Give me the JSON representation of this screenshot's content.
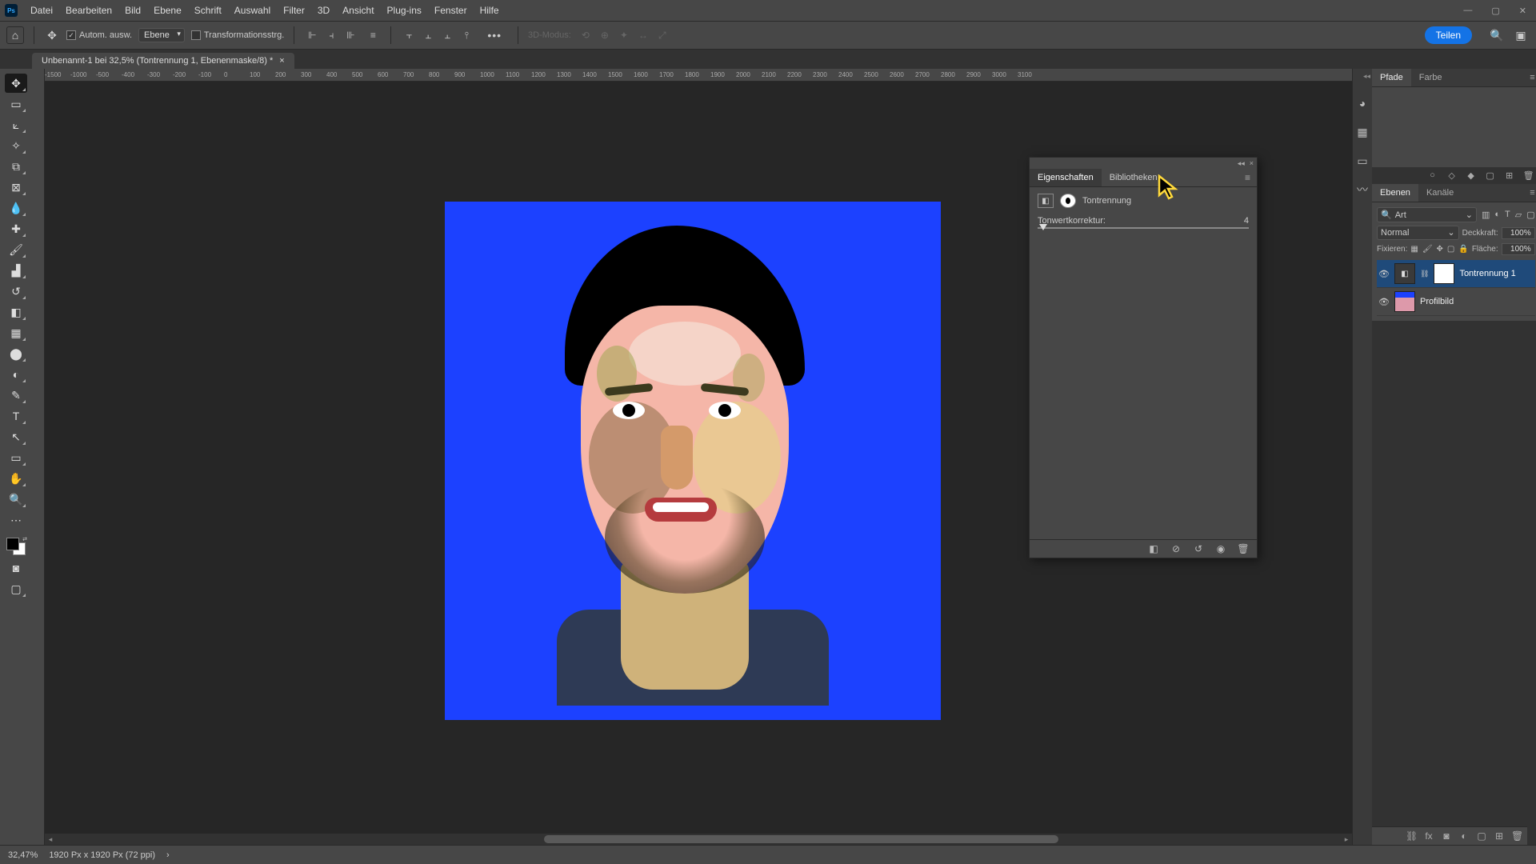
{
  "menu": {
    "items": [
      "Datei",
      "Bearbeiten",
      "Bild",
      "Ebene",
      "Schrift",
      "Auswahl",
      "Filter",
      "3D",
      "Ansicht",
      "Plug-ins",
      "Fenster",
      "Hilfe"
    ],
    "logo": "Ps"
  },
  "options": {
    "auto_select_checked": true,
    "auto_select_label": "Autom. ausw.",
    "layer_dropdown": "Ebene",
    "transform_checked": false,
    "transform_label": "Transformationsstrg.",
    "mode_label_disabled": "3D-Modus:",
    "share_button": "Teilen"
  },
  "document": {
    "tab_title": "Unbenannt-1 bei 32,5% (Tontrennung 1, Ebenenmaske/8) *"
  },
  "ruler": {
    "values": [
      "-1500",
      "-1000",
      "-500",
      "-400",
      "-300",
      "-200",
      "-100",
      "0",
      "100",
      "200",
      "300",
      "400",
      "500",
      "600",
      "700",
      "800",
      "900",
      "1000",
      "1100",
      "1200",
      "1300",
      "1400",
      "1500",
      "1600",
      "1700",
      "1800",
      "1900",
      "2000",
      "2100",
      "2200",
      "2300",
      "2400",
      "2500",
      "2600",
      "2700",
      "2800",
      "2900",
      "3000",
      "3100"
    ]
  },
  "float_panel": {
    "collapse_icon": "◂◂",
    "close_icon": "×",
    "tabs": {
      "properties": "Eigenschaften",
      "libraries": "Bibliotheken"
    },
    "adjustment_name": "Tontrennung",
    "slider_label": "Tonwertkorrektur:",
    "slider_value": "4",
    "footer_icons": {
      "clip": "◧",
      "view": "⊘",
      "reset": "↺",
      "toggle": "◉",
      "delete": "🗑"
    }
  },
  "right": {
    "paths_tabs": {
      "paths": "Pfade",
      "color": "Farbe"
    },
    "layers_tabs": {
      "layers": "Ebenen",
      "channels": "Kanäle"
    },
    "filter_label": "Art",
    "blend_mode": "Normal",
    "opacity_label": "Deckkraft:",
    "opacity_value": "100%",
    "lock_label": "Fixieren:",
    "fill_label": "Fläche:",
    "fill_value": "100%",
    "layers": [
      {
        "name": "Tontrennung 1",
        "type": "adjustment",
        "active": true
      },
      {
        "name": "Profilbild",
        "type": "image",
        "active": false
      }
    ]
  },
  "status": {
    "zoom": "32,47%",
    "doc_info": "1920 Px x 1920 Px (72 ppi)",
    "arrow": "›"
  }
}
